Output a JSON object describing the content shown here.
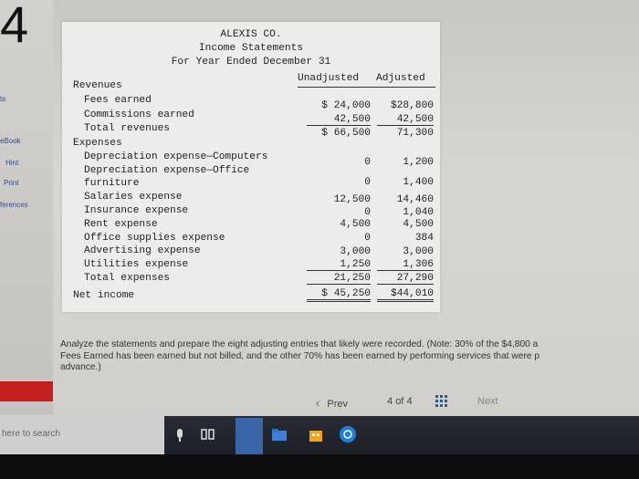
{
  "question_number": "4",
  "sidebar": {
    "items": [
      {
        "label": "ts"
      },
      {
        "label": "eBook"
      },
      {
        "label": "Hint"
      },
      {
        "label": "Print"
      },
      {
        "label": "ferences"
      }
    ]
  },
  "statement": {
    "company": "ALEXIS CO.",
    "title": "Income Statements",
    "period": "For Year Ended December 31",
    "col_unadjusted": "Unadjusted",
    "col_adjusted": "Adjusted",
    "revenues_label": "Revenues",
    "fees_label": "Fees earned",
    "fees_u": "$ 24,000",
    "fees_a": "$28,800",
    "comm_label": "Commissions earned",
    "comm_u": "42,500",
    "comm_a": "42,500",
    "total_rev_label": "Total revenues",
    "total_rev_u": "$ 66,500",
    "total_rev_a": "71,300",
    "expenses_label": "Expenses",
    "dep_comp_label": "Depreciation expense—Computers",
    "dep_comp_u": "0",
    "dep_comp_a": "1,200",
    "dep_off_label_1": "Depreciation expense—Office",
    "dep_off_label_2": "furniture",
    "dep_off_u": "0",
    "dep_off_a": "1,400",
    "sal_label": "Salaries expense",
    "sal_u": "12,500",
    "sal_a": "14,460",
    "ins_label": "Insurance expense",
    "ins_u": "0",
    "ins_a": "1,040",
    "rent_label": "Rent expense",
    "rent_u": "4,500",
    "rent_a": "4,500",
    "sup_label": "Office supplies expense",
    "sup_u": "0",
    "sup_a": "384",
    "adv_label": "Advertising expense",
    "adv_u": "3,000",
    "adv_a": "3,000",
    "util_label": "Utilities expense",
    "util_u": "1,250",
    "util_a": "1,306",
    "total_exp_label": "Total expenses",
    "total_exp_u": "21,250",
    "total_exp_a": "27,290",
    "net_label": "Net income",
    "net_u": "$ 45,250",
    "net_a": "$44,010"
  },
  "instructions": {
    "line1": "Analyze the statements and prepare the eight adjusting entries that likely were recorded. (Note: 30% of the $4,800 a",
    "line2": "Fees Earned has been earned but not billed, and the other 70% has been earned by performing services that were p",
    "line3": "advance.)"
  },
  "nav": {
    "prev_label": "Prev",
    "page_current": "4",
    "page_of": "of",
    "page_total": "4",
    "next_label": "Next"
  },
  "taskbar": {
    "search_placeholder": "here to search"
  }
}
